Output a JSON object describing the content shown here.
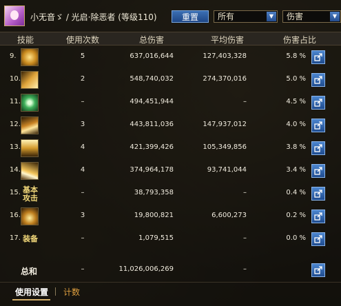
{
  "header": {
    "title": "小无音ゞ / 光启·除恶者 (等级110)",
    "reset_label": "重置",
    "filter_select": "所有",
    "metric_select": "伤害"
  },
  "columns": [
    "技能",
    "使用次数",
    "总伤害",
    "平均伤害",
    "伤害占比"
  ],
  "rows": [
    {
      "index": "9.",
      "skill_icon": "golden-figure-skill-icon",
      "uses": "5",
      "total": "637,016,644",
      "avg": "127,403,328",
      "pct": "5.8 %"
    },
    {
      "index": "10.",
      "skill_icon": "heart-sword-skill-icon",
      "uses": "2",
      "total": "548,740,032",
      "avg": "274,370,016",
      "pct": "5.0 %"
    },
    {
      "index": "11.",
      "skill_icon": "green-orb-skill-icon",
      "uses": "–",
      "total": "494,451,944",
      "avg": "–",
      "pct": "4.5 %"
    },
    {
      "index": "12.",
      "skill_icon": "crescent-slash-skill-icon",
      "uses": "3",
      "total": "443,811,036",
      "avg": "147,937,012",
      "pct": "4.0 %"
    },
    {
      "index": "13.",
      "skill_icon": "rising-blade-skill-icon",
      "uses": "4",
      "total": "421,399,426",
      "avg": "105,349,856",
      "pct": "3.8 %"
    },
    {
      "index": "14.",
      "skill_icon": "wave-slash-skill-icon",
      "uses": "4",
      "total": "374,964,178",
      "avg": "93,741,044",
      "pct": "3.4 %"
    },
    {
      "index": "15.",
      "skill_text": "基本攻击",
      "uses": "–",
      "total": "38,793,358",
      "avg": "–",
      "pct": "0.4 %"
    },
    {
      "index": "16.",
      "skill_icon": "spiked-crown-skill-icon",
      "uses": "3",
      "total": "19,800,821",
      "avg": "6,600,273",
      "pct": "0.2 %"
    },
    {
      "index": "17.",
      "skill_text": "装备",
      "uses": "–",
      "total": "1,079,515",
      "avg": "–",
      "pct": "0.0 %"
    }
  ],
  "total_row": {
    "label": "总和",
    "uses": "–",
    "total": "11,026,006,269",
    "avg": "–"
  },
  "tabs": {
    "active": "使用设置",
    "inactive": "计数"
  }
}
